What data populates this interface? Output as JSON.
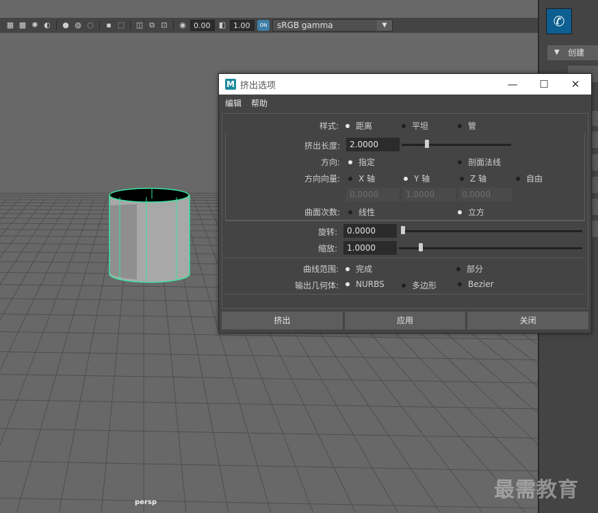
{
  "toolbar": {
    "exposure_value": "0.00",
    "gamma_value": "1.00",
    "color_space": "sRGB gamma",
    "toggle_label": "ON"
  },
  "viewport": {
    "camera_label": "persp"
  },
  "right_panel": {
    "create_tab": "创建"
  },
  "dialog": {
    "title": "挤出选项",
    "menu": [
      "编辑",
      "帮助"
    ],
    "style_label": "样式:",
    "style_options": [
      "距离",
      "平坦",
      "管"
    ],
    "style_selected": "距离",
    "length_label": "挤出长度:",
    "length_value": "2.0000",
    "length_slider_fraction": 0.22,
    "direction_label": "方向:",
    "direction_options": [
      "指定",
      "剖面法线"
    ],
    "direction_selected": "指定",
    "vector_label": "方向向量:",
    "vector_options": [
      "X 轴",
      "Y 轴",
      "Z 轴",
      "自由"
    ],
    "vector_selected": "Y 轴",
    "vector_values": [
      "0.0000",
      "1.0000",
      "0.0000"
    ],
    "degree_label": "曲面次数:",
    "degree_options": [
      "线性",
      "立方"
    ],
    "degree_selected": "立方",
    "rotation_label": "旋转:",
    "rotation_value": "0.0000",
    "rotation_slider_fraction": 0.0,
    "scale_label": "缩放:",
    "scale_value": "1.0000",
    "scale_slider_fraction": 0.11,
    "curve_range_label": "曲线范围:",
    "curve_range_options": [
      "完成",
      "部分"
    ],
    "curve_range_selected": "完成",
    "output_label": "输出几何体:",
    "output_options": [
      "NURBS",
      "多边形",
      "Bezier"
    ],
    "output_selected": "NURBS",
    "buttons": [
      "挤出",
      "应用",
      "关闭"
    ]
  },
  "watermark": "最需教育",
  "colors": {
    "viewport_bg": "#686868",
    "panel_bg": "#444444",
    "selection_green": "#39e6a0",
    "field_bg": "#2b2b2b"
  }
}
